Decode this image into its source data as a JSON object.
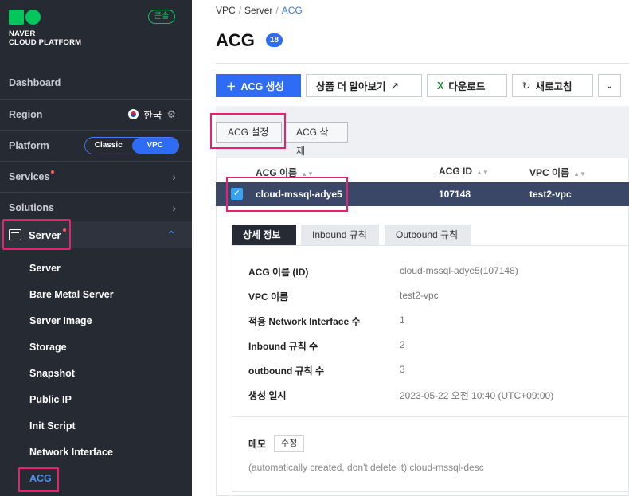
{
  "brand": {
    "line1": "NAVER",
    "line2": "CLOUD PLATFORM",
    "console": "콘솔"
  },
  "sidebar": {
    "dashboard": "Dashboard",
    "region": {
      "label": "Region",
      "value": "한국"
    },
    "platform": {
      "label": "Platform",
      "options": [
        "Classic",
        "VPC"
      ],
      "selected": "VPC"
    },
    "services": "Services",
    "solutions": "Solutions",
    "server": "Server",
    "sub_items": [
      "Server",
      "Bare Metal Server",
      "Server Image",
      "Storage",
      "Snapshot",
      "Public IP",
      "Init Script",
      "Network Interface",
      "ACG"
    ],
    "active_item": "ACG"
  },
  "breadcrumb": [
    "VPC",
    "Server",
    "ACG"
  ],
  "page": {
    "title": "ACG",
    "count": "18"
  },
  "toolbar": {
    "create": "ACG 생성",
    "learn_more": "상품 더 알아보기",
    "download": "다운로드",
    "refresh": "새로고침"
  },
  "actions": {
    "settings": "ACG 설정",
    "delete": "ACG 삭제"
  },
  "table": {
    "headers": [
      "ACG 이름",
      "ACG ID",
      "VPC 이름"
    ],
    "rows": [
      {
        "name": "cloud-mssql-adye5",
        "id": "107148",
        "vpc": "test2-vpc",
        "selected": true
      }
    ]
  },
  "tabs": [
    "상세 정보",
    "Inbound 규칙",
    "Outbound 규칙"
  ],
  "detail": [
    {
      "key": "ACG 이름 (ID)",
      "value": "cloud-mssql-adye5(107148)"
    },
    {
      "key": "VPC 이름",
      "value": "test2-vpc"
    },
    {
      "key": "적용 Network Interface 수",
      "value": "1"
    },
    {
      "key": "Inbound 규칙 수",
      "value": "2"
    },
    {
      "key": "outbound 규칙 수",
      "value": "3"
    },
    {
      "key": "생성 일시",
      "value": "2023-05-22 오전 10:40 (UTC+09:00)"
    }
  ],
  "memo": {
    "label": "메모",
    "edit": "수정",
    "text": "(automatically created, don't delete it) cloud-mssql-desc"
  },
  "colors": {
    "sidebar_bg": "#262a33",
    "accent": "#2e6cf6",
    "brand": "#03c75a",
    "highlight": "#e8206f"
  }
}
